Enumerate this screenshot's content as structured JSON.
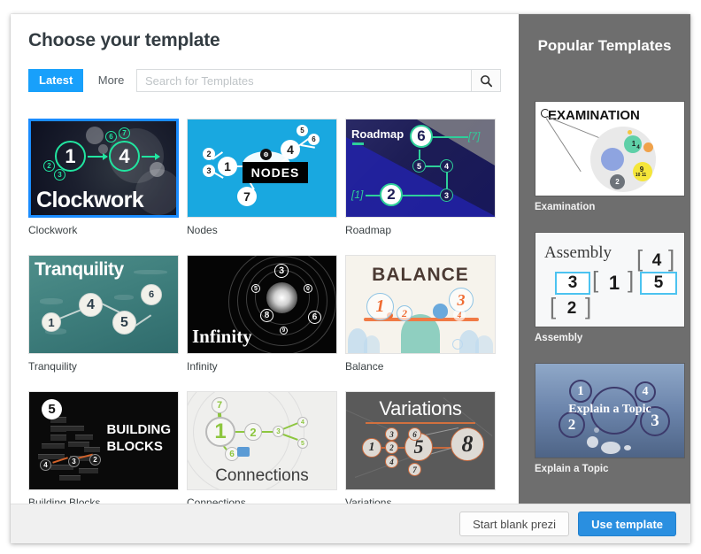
{
  "dialog": {
    "title": "Choose your template"
  },
  "filters": {
    "tabs": [
      {
        "label": "Latest",
        "active": true
      },
      {
        "label": "More",
        "active": false
      }
    ],
    "search": {
      "placeholder": "Search for Templates",
      "value": "",
      "button_icon": "search-icon"
    }
  },
  "templates": [
    {
      "name": "Clockwork",
      "selected": true,
      "art_title": "Clockwork",
      "numbers": [
        "1",
        "4",
        "2",
        "3",
        "6",
        "7"
      ]
    },
    {
      "name": "Nodes",
      "selected": false,
      "art_title": "NODES",
      "numbers": [
        "1",
        "2",
        "3",
        "4",
        "5",
        "6",
        "7"
      ]
    },
    {
      "name": "Roadmap",
      "selected": false,
      "art_title": "Roadmap",
      "numbers": [
        "1",
        "2",
        "3",
        "4",
        "5",
        "6",
        "7"
      ]
    },
    {
      "name": "Tranquility",
      "selected": false,
      "art_title": "Tranquility",
      "numbers": [
        "1",
        "4",
        "5",
        "6"
      ]
    },
    {
      "name": "Infinity",
      "selected": false,
      "art_title": "Infinity",
      "numbers": [
        "3",
        "5",
        "6",
        "8",
        "9",
        "0"
      ]
    },
    {
      "name": "Balance",
      "selected": false,
      "art_title": "BALANCE",
      "numbers": [
        "1",
        "2",
        "3",
        "4"
      ]
    },
    {
      "name": "Building Blocks",
      "selected": false,
      "art_title": "BUILDING BLOCKS",
      "numbers": [
        "5",
        "3",
        "4",
        "2"
      ]
    },
    {
      "name": "Connections",
      "selected": false,
      "art_title": "Connections",
      "numbers": [
        "1",
        "2",
        "3",
        "4",
        "5",
        "6",
        "7"
      ]
    },
    {
      "name": "Variations",
      "selected": false,
      "art_title": "Variations",
      "numbers": [
        "1",
        "2",
        "3",
        "4",
        "5",
        "6",
        "7",
        "8"
      ]
    }
  ],
  "sidebar": {
    "title": "Popular Templates",
    "items": [
      {
        "name": "Examination",
        "art_title": "EXAMINATION",
        "numbers": [
          "1",
          "4",
          "9",
          "10",
          "11",
          "2"
        ]
      },
      {
        "name": "Assembly",
        "art_title": "Assembly",
        "numbers": [
          "1",
          "2",
          "3",
          "4",
          "5"
        ]
      },
      {
        "name": "Explain a Topic",
        "art_title": "Explain a Topic",
        "numbers": [
          "1",
          "2",
          "3",
          "4"
        ]
      }
    ]
  },
  "footer": {
    "blank_label": "Start blank prezi",
    "use_label": "Use template"
  },
  "colors": {
    "accent_blue": "#18a0fb",
    "primary_button": "#2a8fe0",
    "sidebar_bg": "#6e6e6e",
    "footer_bg": "#f0f0f0",
    "selected_border": "#1a8cff"
  }
}
